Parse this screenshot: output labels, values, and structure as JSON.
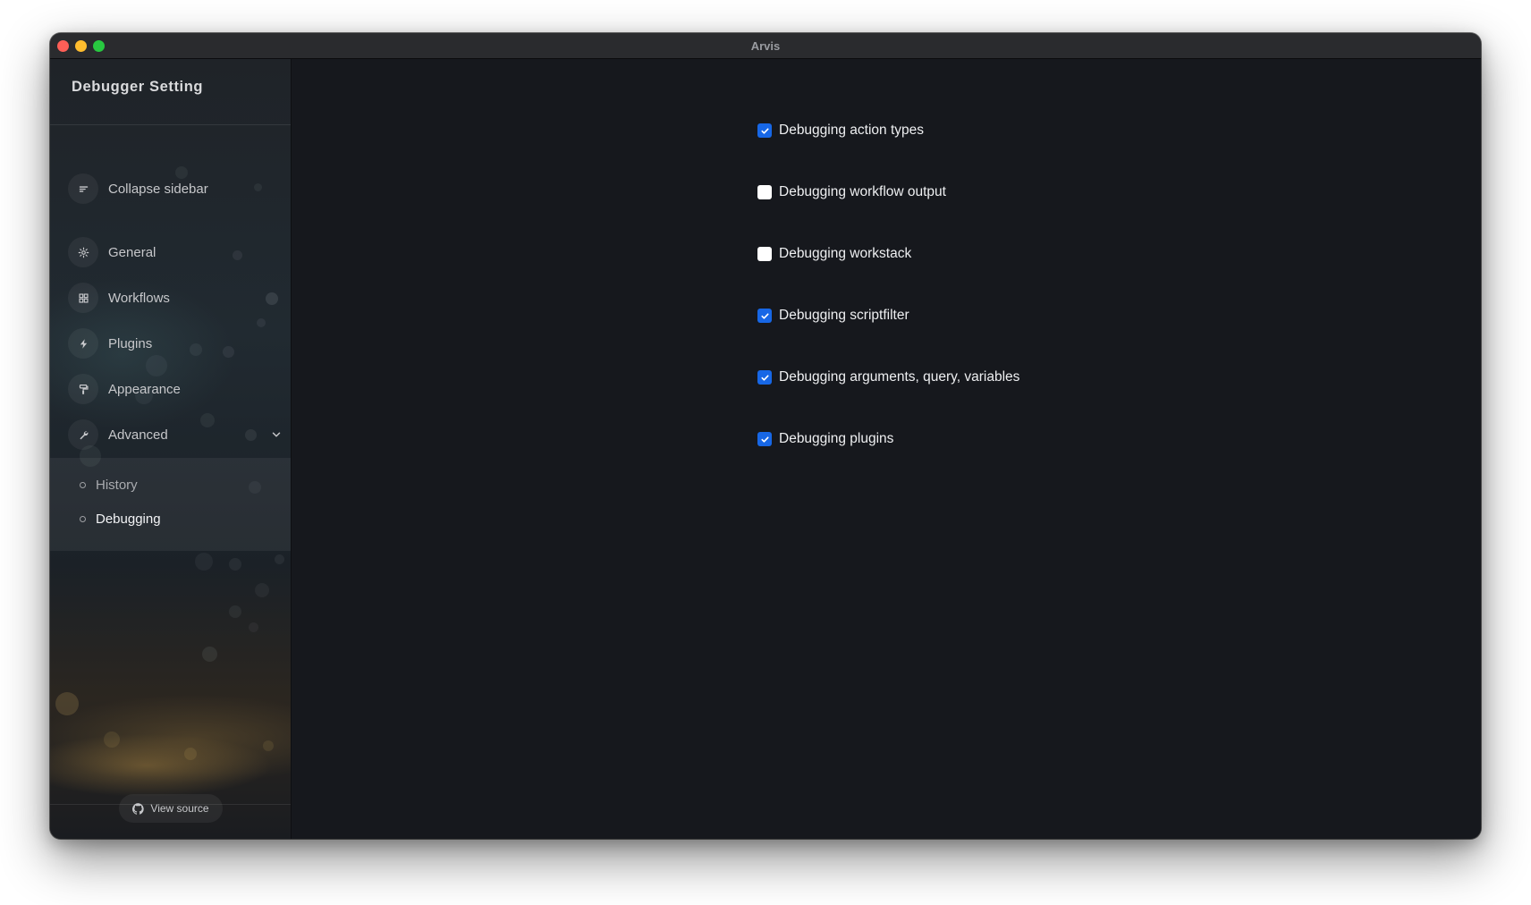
{
  "window": {
    "title": "Arvis"
  },
  "sidebar": {
    "title": "Debugger Setting",
    "collapse_label": "Collapse sidebar",
    "items": [
      {
        "label": "General",
        "icon": "gear-icon"
      },
      {
        "label": "Workflows",
        "icon": "grid-icon"
      },
      {
        "label": "Plugins",
        "icon": "bolt-icon"
      },
      {
        "label": "Appearance",
        "icon": "paint-roller-icon"
      },
      {
        "label": "Advanced",
        "icon": "wrench-icon",
        "expanded": true
      }
    ],
    "submenu": [
      {
        "label": "History",
        "active": false
      },
      {
        "label": "Debugging",
        "active": true
      }
    ],
    "footer": {
      "view_source_label": "View source",
      "icon": "github-icon"
    }
  },
  "main": {
    "options": [
      {
        "label": "Debugging action types",
        "checked": true
      },
      {
        "label": "Debugging workflow output",
        "checked": false
      },
      {
        "label": "Debugging workstack",
        "checked": false
      },
      {
        "label": "Debugging scriptfilter",
        "checked": true
      },
      {
        "label": "Debugging arguments, query, variables",
        "checked": true
      },
      {
        "label": "Debugging plugins",
        "checked": true
      }
    ]
  },
  "colors": {
    "accent": "#1767e6",
    "background": "#16181d",
    "titlebar": "#2a2b2e"
  }
}
